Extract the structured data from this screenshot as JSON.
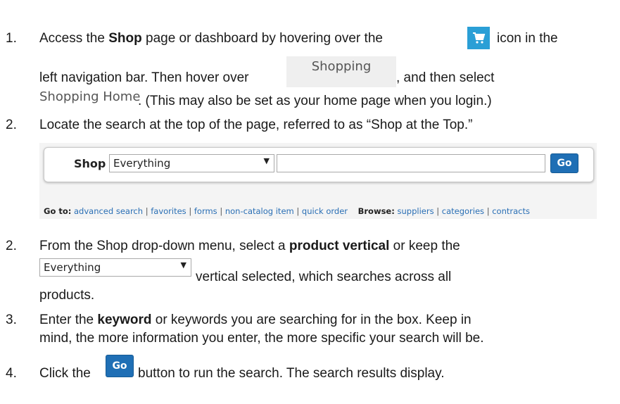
{
  "step1": {
    "num": "1.",
    "line1_pre": "Access the ",
    "line1_bold": "Shop",
    "line1_mid": " page or dashboard by hovering over the",
    "line1_post": "icon in the",
    "line2_pre": "left navigation bar. Then hover over",
    "line2_post": ", and then select",
    "line3_post": ". (This may also be set as your home page when you login.)"
  },
  "shopping_button": {
    "label": "Shopping"
  },
  "shopping_home_link": {
    "label": "Shopping Home"
  },
  "step2a": {
    "num": "2.",
    "text": "Locate the search at the top of the page, referred to as “Shop at the Top.”"
  },
  "shop_widget": {
    "label": "Shop",
    "select_value": "Everything",
    "go_label": "Go",
    "goto_label": "Go to:",
    "goto_links": [
      "advanced search",
      "favorites",
      "forms",
      "non-catalog item",
      "quick order"
    ],
    "browse_label": "Browse:",
    "browse_links": [
      "suppliers",
      "categories",
      "contracts"
    ],
    "separator": "|",
    "go_color": "#1f6fb5"
  },
  "step2b": {
    "num": "2.",
    "line1_pre": "From the Shop drop-down menu, select a ",
    "line1_bold": "product vertical",
    "line1_post": " or keep the",
    "select_value": "Everything",
    "line2_post": "vertical selected, which searches across all",
    "line3": "products."
  },
  "step3": {
    "num": "3.",
    "line1_pre": "Enter the ",
    "line1_bold": "keyword",
    "line1_post": " or keywords you are searching for in the box. Keep in",
    "line2": "mind, the more information you enter, the more specific your search will be."
  },
  "step4": {
    "num": "4.",
    "pre": "Click the",
    "go_label": "Go",
    "post": "button to run the search. The search results display."
  },
  "icons": {
    "cart": "shopping-cart-icon",
    "dropdown": "dropdown-arrow-icon"
  },
  "colors": {
    "cart_bg": "#2a9fd6",
    "link": "#2a6fb5"
  }
}
